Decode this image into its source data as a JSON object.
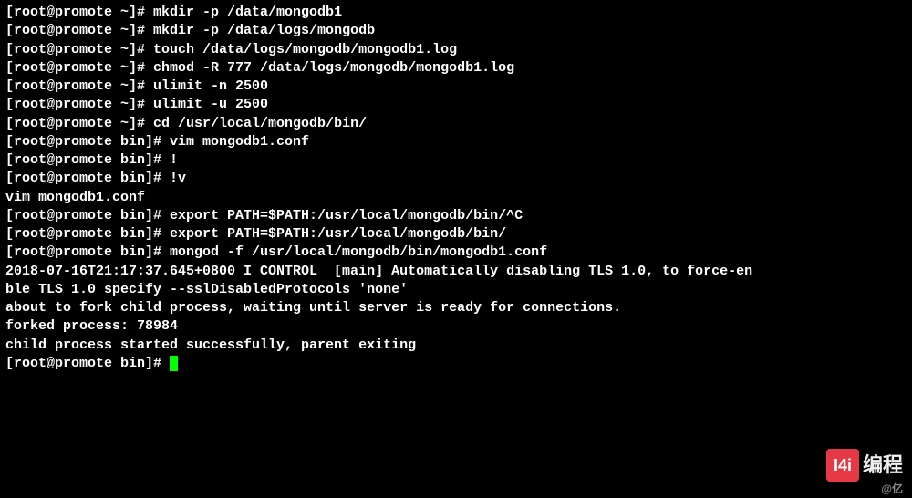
{
  "terminal": {
    "lines": [
      {
        "prompt": "[root@promote ~]# ",
        "cmd": "mkdir -p /data/mongodb1"
      },
      {
        "prompt": "[root@promote ~]# ",
        "cmd": "mkdir -p /data/logs/mongodb"
      },
      {
        "prompt": "[root@promote ~]# ",
        "cmd": "touch /data/logs/mongodb/mongodb1.log"
      },
      {
        "prompt": "[root@promote ~]# ",
        "cmd": "chmod -R 777 /data/logs/mongodb/mongodb1.log"
      },
      {
        "prompt": "[root@promote ~]# ",
        "cmd": "ulimit -n 2500"
      },
      {
        "prompt": "[root@promote ~]# ",
        "cmd": "ulimit -u 2500"
      },
      {
        "prompt": "[root@promote ~]# ",
        "cmd": "cd /usr/local/mongodb/bin/"
      },
      {
        "prompt": "[root@promote bin]# ",
        "cmd": "vim mongodb1.conf"
      },
      {
        "prompt": "[root@promote bin]# ",
        "cmd": "!"
      },
      {
        "prompt": "[root@promote bin]# ",
        "cmd": "!v"
      },
      {
        "prompt": "",
        "cmd": "vim mongodb1.conf"
      },
      {
        "prompt": "[root@promote bin]# ",
        "cmd": "export PATH=$PATH:/usr/local/mongodb/bin/^C"
      },
      {
        "prompt": "[root@promote bin]# ",
        "cmd": "export PATH=$PATH:/usr/local/mongodb/bin/"
      },
      {
        "prompt": "[root@promote bin]# ",
        "cmd": "mongod -f /usr/local/mongodb/bin/mongodb1.conf"
      },
      {
        "prompt": "",
        "cmd": "2018-07-16T21:17:37.645+0800 I CONTROL  [main] Automatically disabling TLS 1.0, to force-en"
      },
      {
        "prompt": "",
        "cmd": "ble TLS 1.0 specify --sslDisabledProtocols 'none'"
      },
      {
        "prompt": "",
        "cmd": "about to fork child process, waiting until server is ready for connections."
      },
      {
        "prompt": "",
        "cmd": "forked process: 78984"
      },
      {
        "prompt": "",
        "cmd": "child process started successfully, parent exiting"
      }
    ],
    "final_prompt": "[root@promote bin]# "
  },
  "watermark": {
    "logo": "I4i",
    "text": "编程",
    "sub": "@亿"
  }
}
